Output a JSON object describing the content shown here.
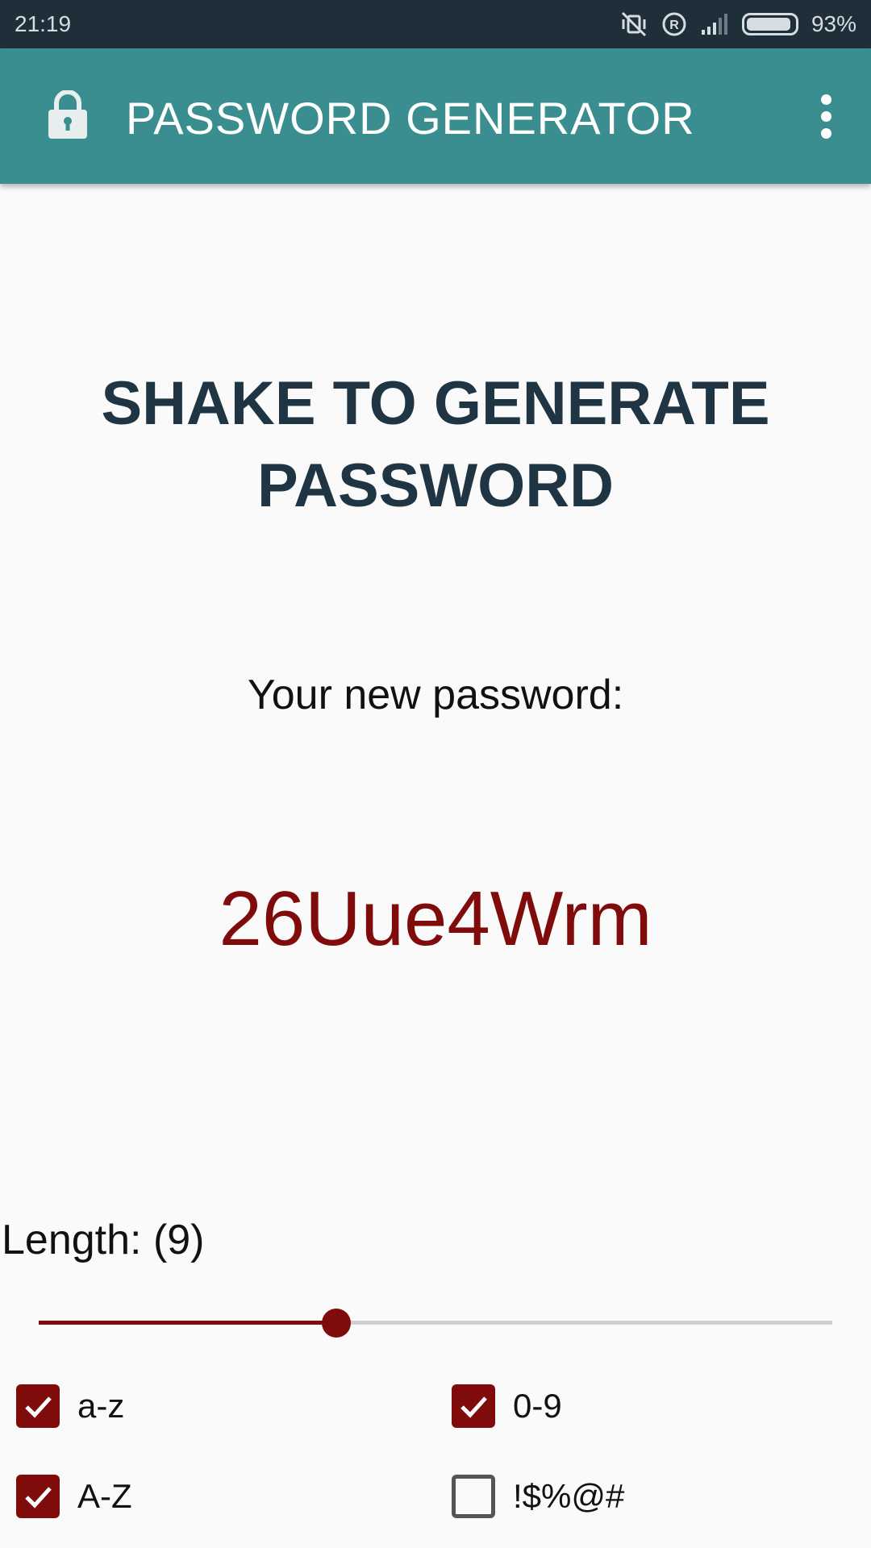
{
  "status_bar": {
    "time": "21:19",
    "battery_percent_text": "93%",
    "battery_level": 0.93,
    "icons": [
      "mute-vibrate-icon",
      "registered-icon",
      "signal-icon",
      "battery-icon"
    ]
  },
  "app_bar": {
    "title": "PASSWORD GENERATOR",
    "icon": "lock-icon",
    "overflow_icon": "overflow-menu-icon",
    "background": "#3a8e8f"
  },
  "main": {
    "headline": "SHAKE TO GENERATE PASSWORD",
    "subtitle": "Your new password:",
    "password": "26Uue4Wrm",
    "password_color": "#7f0b0b"
  },
  "length": {
    "label": "Length: (9)",
    "value": 9,
    "slider_fraction": 0.375
  },
  "options": [
    {
      "label": "a-z",
      "checked": true
    },
    {
      "label": "0-9",
      "checked": true
    },
    {
      "label": "A-Z",
      "checked": true
    },
    {
      "label": "!$%@#",
      "checked": false
    }
  ],
  "colors": {
    "accent": "#7f0b0b",
    "headline": "#203543",
    "status_bar": "#1f2f3a"
  }
}
